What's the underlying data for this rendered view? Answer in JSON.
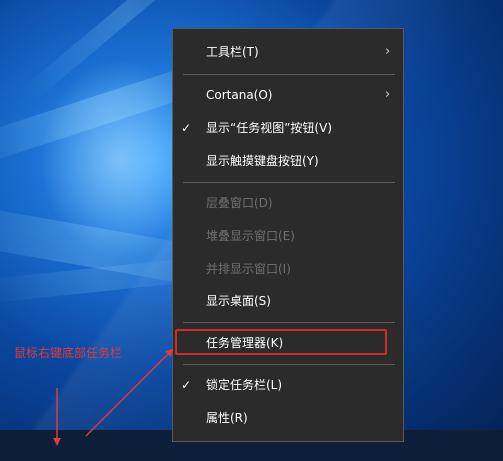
{
  "context_menu": {
    "items": [
      {
        "label": "工具栏(T)",
        "has_submenu": true,
        "checked": false,
        "enabled": true
      },
      {
        "label": "Cortana(O)",
        "has_submenu": true,
        "checked": false,
        "enabled": true
      },
      {
        "label": "显示“任务视图”按钮(V)",
        "has_submenu": false,
        "checked": true,
        "enabled": true
      },
      {
        "label": "显示触摸键盘按钮(Y)",
        "has_submenu": false,
        "checked": false,
        "enabled": true
      },
      {
        "label": "层叠窗口(D)",
        "has_submenu": false,
        "checked": false,
        "enabled": false
      },
      {
        "label": "堆叠显示窗口(E)",
        "has_submenu": false,
        "checked": false,
        "enabled": false
      },
      {
        "label": "并排显示窗口(I)",
        "has_submenu": false,
        "checked": false,
        "enabled": false
      },
      {
        "label": "显示桌面(S)",
        "has_submenu": false,
        "checked": false,
        "enabled": true
      },
      {
        "label": "任务管理器(K)",
        "has_submenu": false,
        "checked": false,
        "enabled": true,
        "highlighted": true
      },
      {
        "label": "锁定任务栏(L)",
        "has_submenu": false,
        "checked": true,
        "enabled": true
      },
      {
        "label": "属性(R)",
        "has_submenu": false,
        "checked": false,
        "enabled": true
      }
    ],
    "check_glyph": "✓",
    "submenu_glyph": "›"
  },
  "annotation": {
    "text": "鼠标右键底部任务栏",
    "color": "#e23a3a"
  },
  "colors": {
    "menu_background": "#2b2b2b",
    "menu_text": "#ffffff",
    "disabled_text": "#6f6f6f",
    "highlight_border": "#d02a2a",
    "taskbar": "#0c1e38"
  }
}
